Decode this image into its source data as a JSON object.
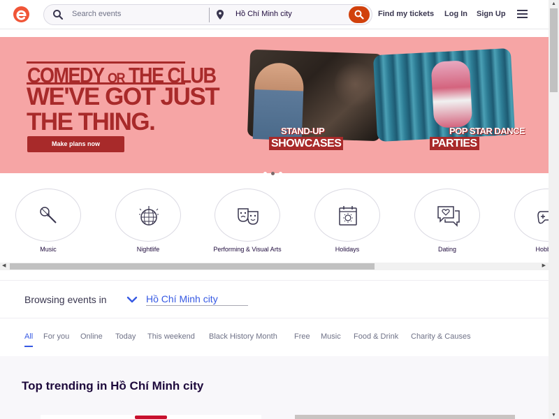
{
  "header": {
    "logo_icon": "eventbrite-logo-icon",
    "search_placeholder": "Search events",
    "location_value": "Hồ Chí Minh city",
    "nav": {
      "find_tickets": "Find my tickets",
      "login": "Log In",
      "signup": "Sign Up"
    },
    "menu_icon": "hamburger-menu-icon",
    "brand_color": "#f05537",
    "search_button_color": "#d1410c"
  },
  "hero": {
    "title_small_a": "COMEDY ",
    "title_small_or": "OR",
    "title_small_b": " THE CLUB",
    "title_line1": "WE'VE GOT JUST",
    "title_line2": "THE THING.",
    "cta": "Make plans now",
    "tag1_top": "STAND-UP",
    "tag1_bottom": "SHOWCASES",
    "tag2_top": "POP STAR DANCE",
    "tag2_bottom": "PARTIES",
    "background_color": "#f6a5a5",
    "accent_color": "#a82a2a",
    "active_slide": 2,
    "slide_count": 3
  },
  "categories": [
    {
      "label": "Music",
      "icon": "microphone-icon"
    },
    {
      "label": "Nightlife",
      "icon": "disco-ball-icon"
    },
    {
      "label": "Performing & Visual Arts",
      "icon": "theater-masks-icon"
    },
    {
      "label": "Holidays",
      "icon": "calendar-sun-icon"
    },
    {
      "label": "Dating",
      "icon": "chat-heart-icon"
    },
    {
      "label": "Hobbies",
      "icon": "gamepad-icon"
    }
  ],
  "browse": {
    "label": "Browsing events in",
    "city": "Hồ Chí Minh city"
  },
  "tabs": [
    {
      "label": "All",
      "active": true
    },
    {
      "label": "For you"
    },
    {
      "label": "Online"
    },
    {
      "label": "Today"
    },
    {
      "label": "This weekend"
    },
    {
      "label": "Black History Month"
    },
    {
      "label": "Free"
    },
    {
      "label": "Music"
    },
    {
      "label": "Food & Drink"
    },
    {
      "label": "Charity & Causes"
    }
  ],
  "trending": {
    "title": "Top trending in Hồ Chí Minh city"
  }
}
